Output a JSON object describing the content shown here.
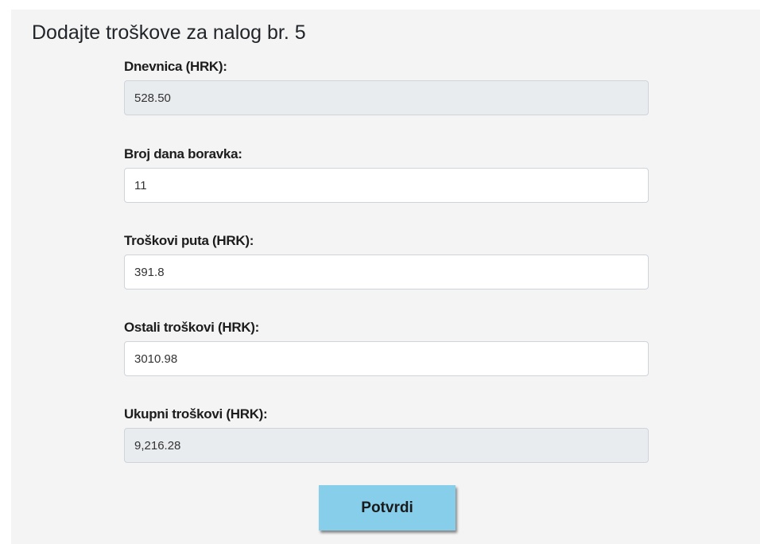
{
  "page": {
    "title": "Dodajte troškove za nalog br. 5"
  },
  "form": {
    "dnevnica": {
      "label": "Dnevnica (HRK):",
      "value": "528.50"
    },
    "broj_dana": {
      "label": "Broj dana boravka:",
      "value": "11"
    },
    "troskovi_puta": {
      "label": "Troškovi puta (HRK):",
      "value": "391.8"
    },
    "ostali_troskovi": {
      "label": "Ostali troškovi (HRK):",
      "value": "3010.98"
    },
    "ukupni_troskovi": {
      "label": "Ukupni troškovi (HRK):",
      "value": "9,216.28"
    },
    "submit_label": "Potvrdi"
  },
  "colors": {
    "panel_background": "#f4f4f4",
    "readonly_background": "#e9ecef",
    "button_background": "#87ceeb"
  }
}
